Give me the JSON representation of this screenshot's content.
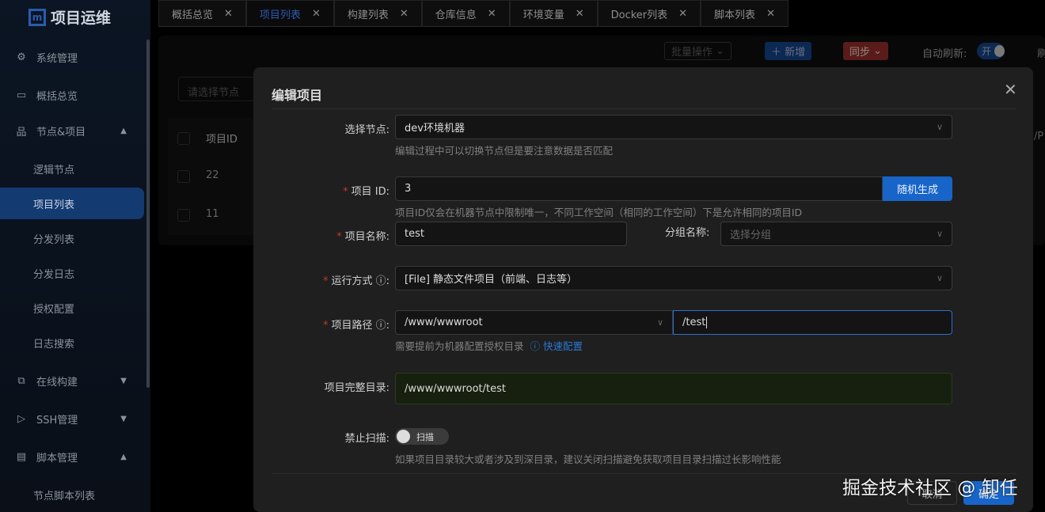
{
  "app": {
    "title": "项目运维",
    "logo_mark": "m"
  },
  "sidebar": {
    "items": [
      {
        "label": "系统管理",
        "icon": "gear-icon"
      },
      {
        "label": "概括总览",
        "icon": "laptop-icon"
      },
      {
        "label": "节点&项目",
        "icon": "sitemap-icon"
      },
      {
        "label": "逻辑节点"
      },
      {
        "label": "项目列表"
      },
      {
        "label": "分发列表"
      },
      {
        "label": "分发日志"
      },
      {
        "label": "授权配置"
      },
      {
        "label": "日志搜索"
      },
      {
        "label": "在线构建",
        "icon": "build-icon"
      },
      {
        "label": "SSH管理",
        "icon": "terminal-icon"
      },
      {
        "label": "脚本管理",
        "icon": "file-icon"
      },
      {
        "label": "节点脚本列表"
      }
    ]
  },
  "tabs": [
    {
      "label": "概括总览"
    },
    {
      "label": "项目列表"
    },
    {
      "label": "构建列表"
    },
    {
      "label": "仓库信息"
    },
    {
      "label": "环境变量"
    },
    {
      "label": "Docker列表"
    },
    {
      "label": "脚本列表"
    }
  ],
  "toolbar": {
    "batch": "批量操作",
    "add": "新增",
    "sync": "同步",
    "auto_refresh": "自动刷新:",
    "toggle_on": "开",
    "refresh_partial": "刷"
  },
  "filter": {
    "node_placeholder": "请选择节点"
  },
  "table": {
    "header": "项目ID",
    "rows": [
      {
        "id": "22"
      },
      {
        "id": "11"
      }
    ],
    "partial_col": "/P"
  },
  "modal": {
    "title": "编辑项目",
    "node_label": "选择节点:",
    "node_value": "dev环境机器",
    "node_help": "编辑过程中可以切换节点但是要注意数据是否匹配",
    "id_label": "项目 ID:",
    "id_value": "3",
    "id_button": "随机生成",
    "id_help": "项目ID仅会在机器节点中限制唯一，不同工作空间（相同的工作空间）下是允许相同的项目ID",
    "name_label": "项目名称:",
    "name_value": "test",
    "group_label": "分组名称:",
    "group_placeholder": "选择分组",
    "run_label": "运行方式",
    "run_value": "[File] 静态文件项目（前端、日志等）",
    "path_label": "项目路径",
    "path_root": "/www/wwwroot",
    "path_sub": "/test",
    "path_help": "需要提前为机器配置授权目录",
    "quick_config": "快速配置",
    "full_label": "项目完整目录:",
    "full_value": "/www/wwwroot/test",
    "scan_label": "禁止扫描:",
    "scan_toggle": "扫描",
    "scan_help": "如果项目目录较大或者涉及到深目录，建议关闭扫描避免获取项目目录扫描过长影响性能",
    "cancel": "取消",
    "ok": "确定"
  },
  "watermark": "掘金技术社区 @ 卸任"
}
